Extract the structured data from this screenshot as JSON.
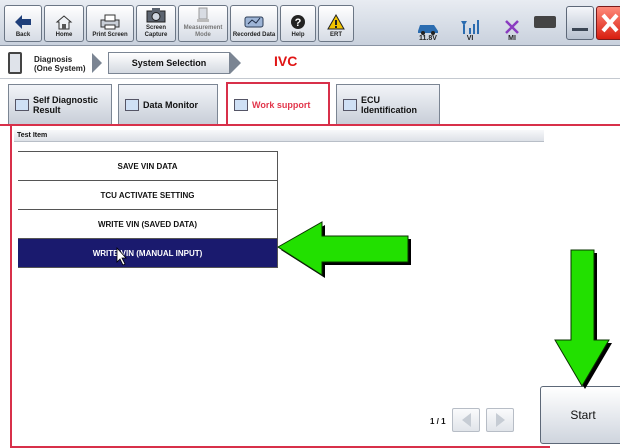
{
  "toolbar": {
    "buttons": [
      {
        "label": "Back",
        "icon": "back-arrow-icon"
      },
      {
        "label": "Home",
        "icon": "home-icon"
      },
      {
        "label": "Print Screen",
        "icon": "printer-icon"
      },
      {
        "label": "Screen Capture",
        "icon": "camera-icon"
      },
      {
        "label": "Measurement Mode",
        "icon": "measurement-icon"
      },
      {
        "label": "Recorded Data",
        "icon": "recorded-data-icon"
      },
      {
        "label": "Help",
        "icon": "help-icon"
      },
      {
        "label": "ERT",
        "icon": "warning-icon"
      }
    ],
    "status": {
      "battery": "11.8V",
      "vi": "VI",
      "mi": "MI"
    }
  },
  "breadcrumb": {
    "step1": "Diagnosis (One System)",
    "step2": "System Selection",
    "current": "IVC"
  },
  "tabs": [
    {
      "label": "Self Diagnostic Result"
    },
    {
      "label": "Data Monitor"
    },
    {
      "label": "Work support",
      "active": true
    },
    {
      "label": "ECU Identification"
    }
  ],
  "table": {
    "header": "Test Item",
    "rows": [
      "SAVE VIN DATA",
      "TCU ACTIVATE SETTING",
      "WRITE VIN (SAVED DATA)",
      "WRITE VIN (MANUAL INPUT)"
    ],
    "selected_index": 3
  },
  "pager": {
    "text": "1 / 1"
  },
  "start_button": {
    "label": "Start"
  },
  "colors": {
    "accent": "#d8304a",
    "selected_row": "#1a1a6e",
    "arrow_green": "#22e000",
    "ivc_red": "#e01515"
  }
}
